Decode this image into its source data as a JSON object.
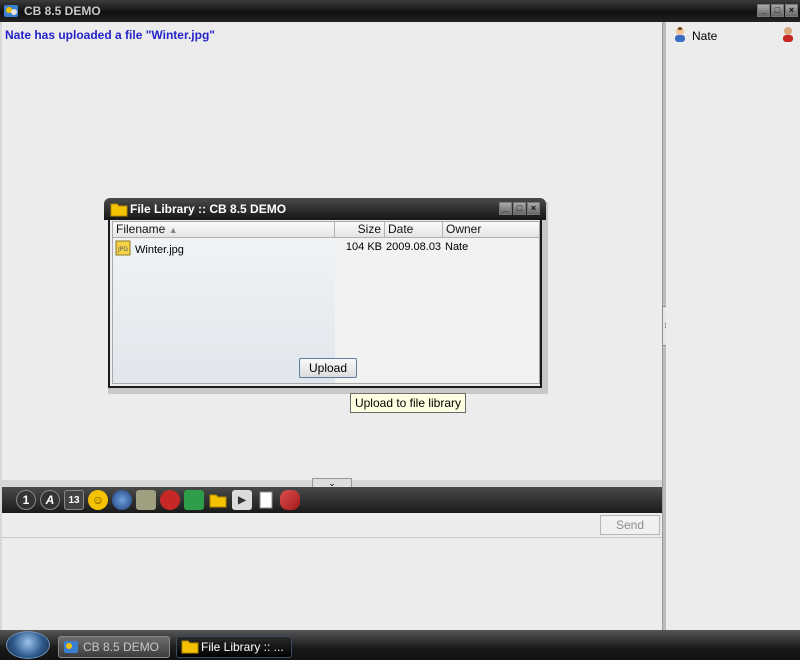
{
  "window": {
    "title": "CB 8.5 DEMO"
  },
  "chat": {
    "message": "Nate has uploaded a file \"Winter.jpg\""
  },
  "users": [
    {
      "name": "Nate"
    }
  ],
  "toolbar": {
    "font_size": "13"
  },
  "input": {
    "send_label": "Send"
  },
  "dialog": {
    "title": "File Library :: CB 8.5 DEMO",
    "columns": [
      "Filename",
      "Size",
      "Date",
      "Owner"
    ],
    "files": [
      {
        "filename": "Winter.jpg",
        "size": "104 KB",
        "date": "2009.08.03",
        "owner": "Nate"
      }
    ],
    "upload_label": "Upload"
  },
  "tooltip": {
    "text": "Upload to file library"
  },
  "taskbar": {
    "items": [
      {
        "label": "CB 8.5 DEMO"
      },
      {
        "label": "File Library :: ..."
      }
    ]
  },
  "colors": {
    "message": "#2323c8",
    "titlebar": "#1a1a1a",
    "folder": "#f4c200"
  }
}
